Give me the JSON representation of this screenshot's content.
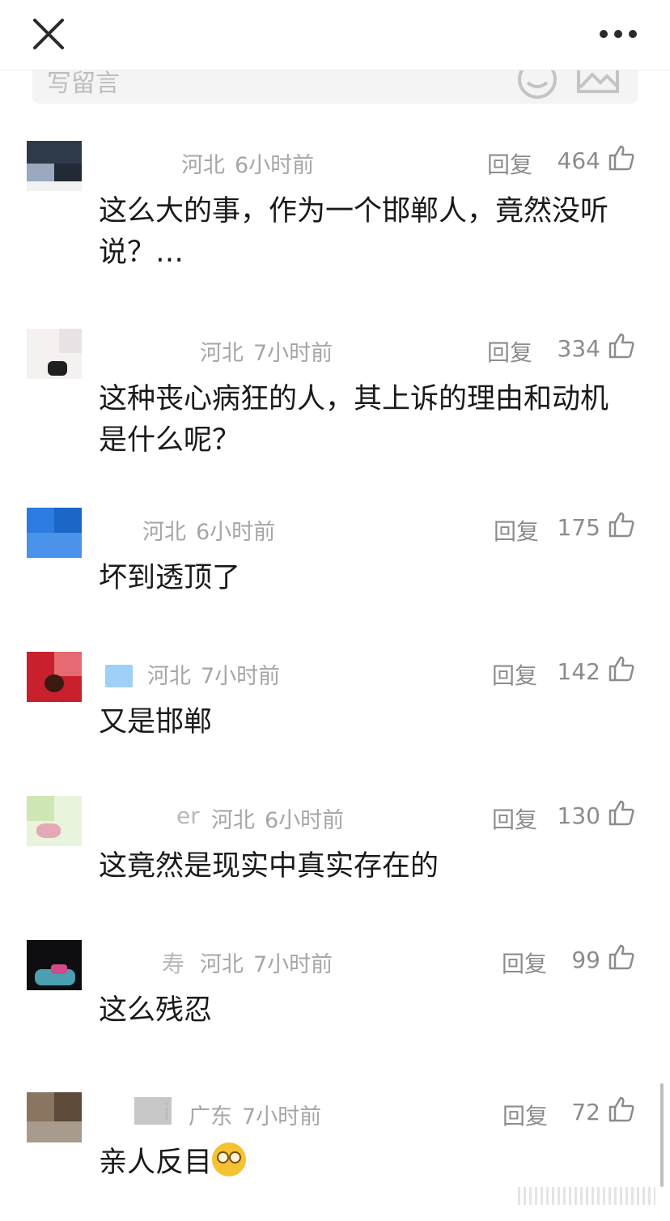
{
  "topbar": {
    "close_icon": "close-icon",
    "more_icon": "more-dots-icon"
  },
  "input": {
    "placeholder": "写留言",
    "emoji_icon": "emoji-icon",
    "image_icon": "image-icon"
  },
  "comments": [
    {
      "username": "",
      "location": "河北",
      "time": "6小时前",
      "reply": "回复",
      "likes": "464",
      "text": "这么大的事，作为一个邯郸人，竟然没听说？…"
    },
    {
      "username": "",
      "location": "河北",
      "time": "7小时前",
      "reply": "回复",
      "likes": "334",
      "text": "这种丧心病狂的人，其上诉的理由和动机是什么呢？"
    },
    {
      "username": "",
      "location": "河北",
      "time": "6小时前",
      "reply": "回复",
      "likes": "175",
      "text": "坏到透顶了"
    },
    {
      "username": "",
      "location": "河北",
      "time": "7小时前",
      "reply": "回复",
      "likes": "142",
      "text": "又是邯郸"
    },
    {
      "username": "er",
      "location": "河北",
      "time": "6小时前",
      "reply": "回复",
      "likes": "130",
      "text": "这竟然是现实中真实存在的"
    },
    {
      "username": "寿",
      "location": "河北",
      "time": "7小时前",
      "reply": "回复",
      "likes": "99",
      "text": "这么残忍"
    },
    {
      "username": "i",
      "location": "广东",
      "time": "7小时前",
      "reply": "回复",
      "likes": "72",
      "text": "亲人反目",
      "emoji": "dizzy-face-emoji"
    }
  ],
  "colors": {
    "muted_text": "#a6a6a6",
    "body_text": "#1a1a1a",
    "input_bg": "#f4f4f4"
  }
}
